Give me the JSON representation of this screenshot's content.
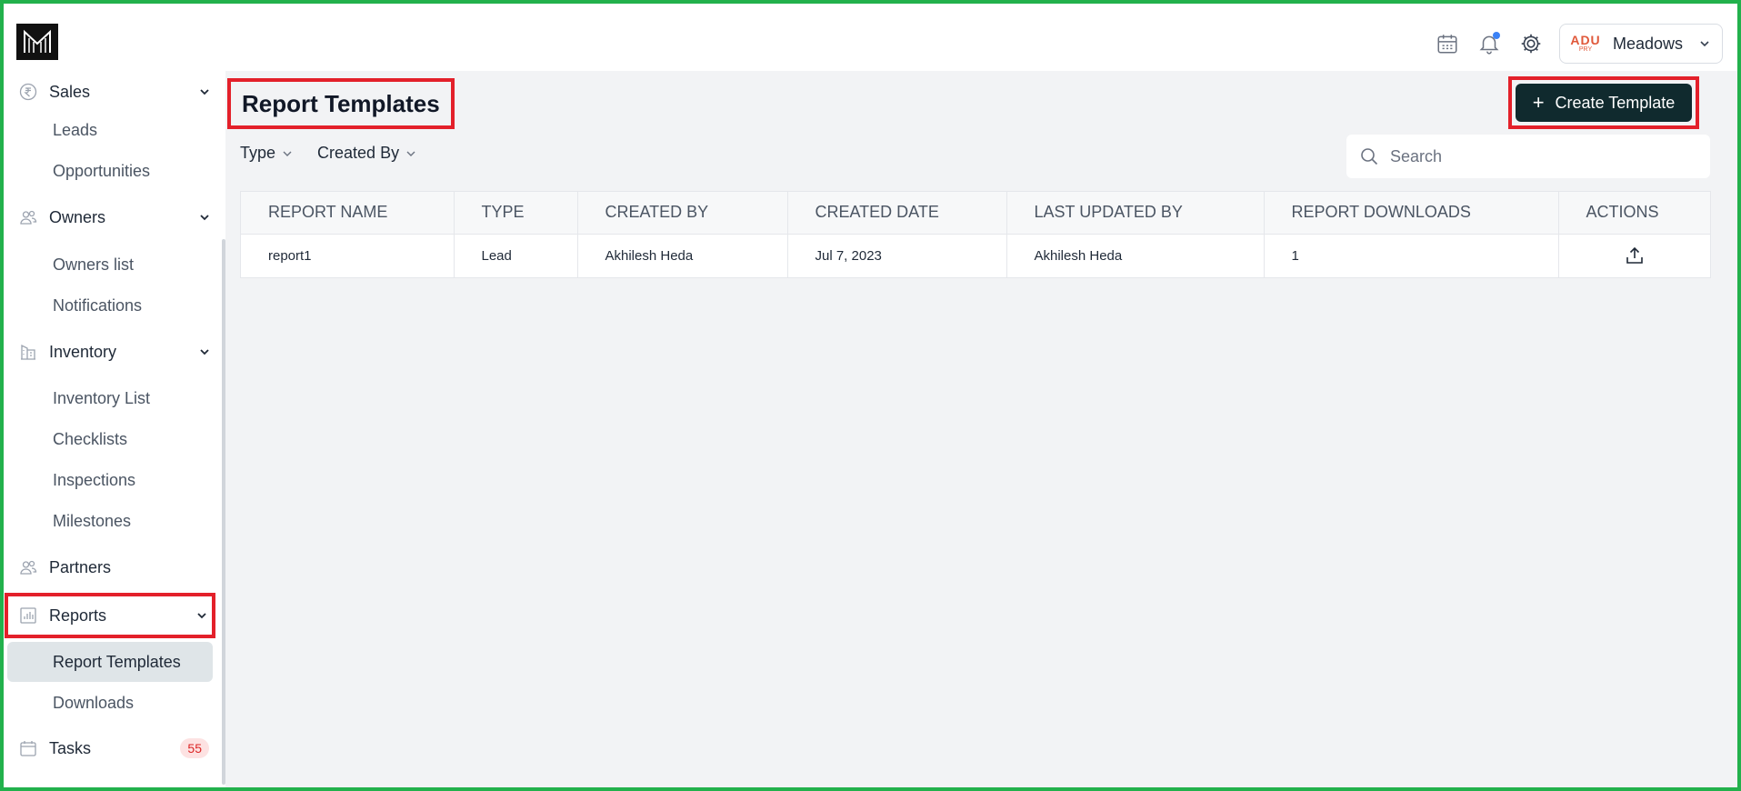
{
  "org": {
    "name": "Meadows",
    "logo_text": "ADU",
    "logo_sub": "PRY"
  },
  "sidebar": {
    "sales": {
      "label": "Sales",
      "items": [
        "Leads",
        "Opportunities"
      ]
    },
    "owners": {
      "label": "Owners",
      "items": [
        "Owners list",
        "Notifications"
      ]
    },
    "inventory": {
      "label": "Inventory",
      "items": [
        "Inventory List",
        "Checklists",
        "Inspections",
        "Milestones"
      ]
    },
    "partners": {
      "label": "Partners"
    },
    "reports": {
      "label": "Reports",
      "items": [
        "Report Templates",
        "Downloads"
      ],
      "active_item": "Report Templates"
    },
    "tasks": {
      "label": "Tasks",
      "badge": "55"
    }
  },
  "page": {
    "title": "Report Templates",
    "create_button": "Create Template",
    "filters": [
      "Type",
      "Created By"
    ],
    "search_placeholder": "Search"
  },
  "table": {
    "columns": [
      "REPORT NAME",
      "TYPE",
      "CREATED BY",
      "CREATED DATE",
      "LAST UPDATED BY",
      "REPORT DOWNLOADS",
      "ACTIONS"
    ],
    "rows": [
      [
        "report1",
        "Lead",
        "Akhilesh Heda",
        "Jul 7, 2023",
        "Akhilesh Heda",
        "1"
      ]
    ]
  },
  "colors": {
    "accent_dark": "#102a2e",
    "highlight": "#e3202a",
    "frame": "#22b14c",
    "notification_dot": "#3b82f6"
  }
}
